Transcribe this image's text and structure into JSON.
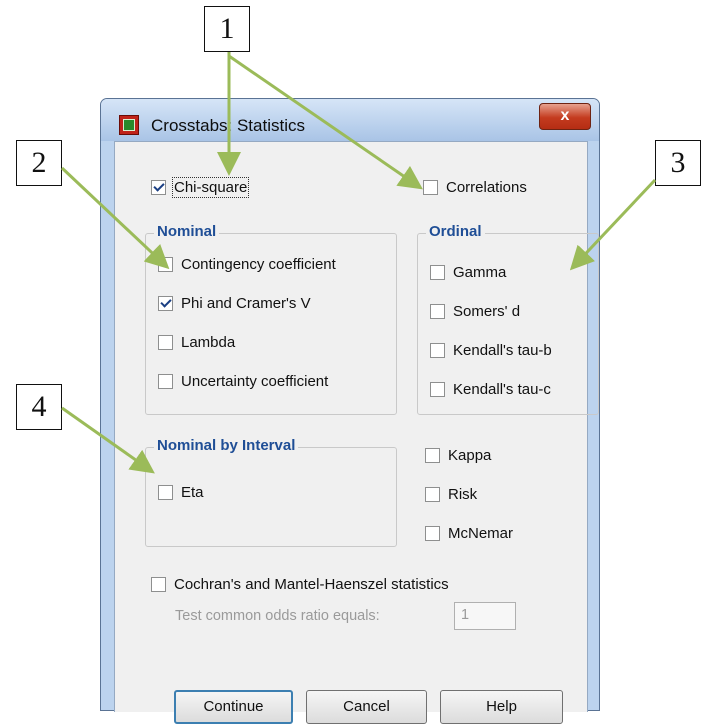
{
  "window": {
    "title": "Crosstabs: Statistics",
    "close_label": "x"
  },
  "top": {
    "chi_square": {
      "label": "Chi-square",
      "mnemonic": "i",
      "checked": true
    },
    "correlations": {
      "label": "Correlations",
      "mnemonic": "r",
      "checked": false
    }
  },
  "nominal": {
    "title": "Nominal",
    "items": [
      {
        "label": "Contingency coefficient",
        "checked": false
      },
      {
        "label": "Phi and Cramer's V",
        "checked": true
      },
      {
        "label": "Lambda",
        "checked": false
      },
      {
        "label": "Uncertainty coefficient",
        "checked": false
      }
    ]
  },
  "ordinal": {
    "title": "Ordinal",
    "items": [
      {
        "label": "Gamma",
        "checked": false
      },
      {
        "label": "Somers' d",
        "checked": false
      },
      {
        "label": "Kendall's tau-b",
        "checked": false
      },
      {
        "label": "Kendall's tau-c",
        "checked": false
      }
    ]
  },
  "nominal_by_interval": {
    "title": "Nominal by Interval",
    "items": [
      {
        "label": "Eta",
        "checked": false
      }
    ]
  },
  "other": {
    "items": [
      {
        "label": "Kappa",
        "checked": false
      },
      {
        "label": "Risk",
        "checked": false
      },
      {
        "label": "McNemar",
        "checked": false
      }
    ]
  },
  "cochran": {
    "label": "Cochran's and Mantel-Haenszel statistics",
    "checked": false
  },
  "odds": {
    "label": "Test common odds ratio equals:",
    "value": "1"
  },
  "buttons": {
    "continue": "Continue",
    "cancel": "Cancel",
    "help": "Help"
  },
  "callouts": [
    "1",
    "2",
    "3",
    "4"
  ],
  "colors": {
    "arrow": "#9bbb59",
    "group_title": "#1f4e96",
    "close_button": "#c43b1f"
  }
}
